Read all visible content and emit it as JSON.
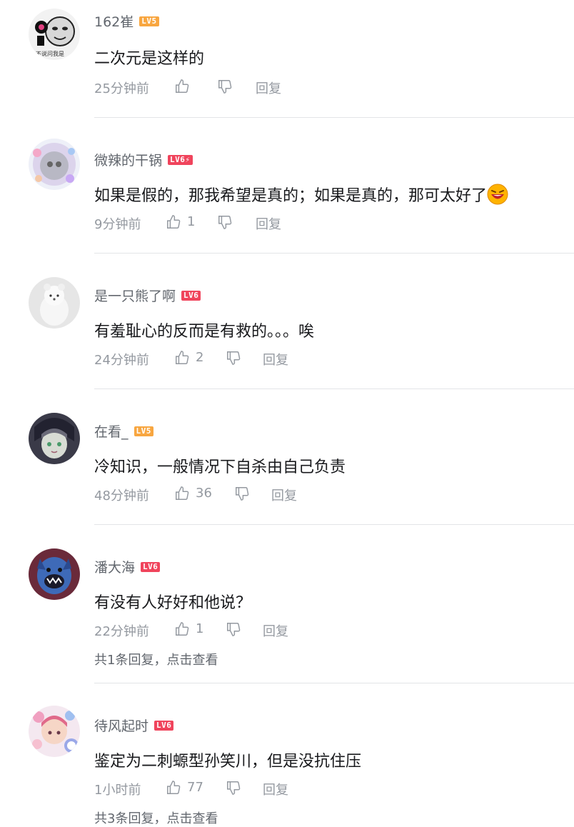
{
  "comments": [
    {
      "username": "162崔",
      "level": "LV5",
      "content": "二次元是这样的",
      "time": "25分钟前",
      "likes": "",
      "reply_label": "回复",
      "sub_replies": "",
      "avatar_caption": "不说问我是"
    },
    {
      "username": "微辣的干锅",
      "level": "LV6⚡",
      "content": "如果是假的，那我希望是真的；如果是真的，那可太好了",
      "time": "9分钟前",
      "likes": "1",
      "reply_label": "回复",
      "sub_replies": ""
    },
    {
      "username": "是一只熊了啊",
      "level": "LV6",
      "content": "有羞耻心的反而是有救的。。。唉",
      "time": "24分钟前",
      "likes": "2",
      "reply_label": "回复",
      "sub_replies": ""
    },
    {
      "username": "在看_",
      "level": "LV5",
      "content": "冷知识，一般情况下自杀由自己负责",
      "time": "48分钟前",
      "likes": "36",
      "reply_label": "回复",
      "sub_replies": ""
    },
    {
      "username": "潘大海",
      "level": "LV6",
      "content": "有没有人好好和他说？",
      "time": "22分钟前",
      "likes": "1",
      "reply_label": "回复",
      "sub_replies": "共1条回复，点击查看"
    },
    {
      "username": "待风起时",
      "level": "LV6",
      "content": "鉴定为二刺螈型孙笑川，但是没抗住压",
      "time": "1小时前",
      "likes": "77",
      "reply_label": "回复",
      "sub_replies": "共3条回复，点击查看"
    }
  ],
  "colors": {
    "username": "#61666d",
    "meta": "#9499a0",
    "lv5": "#f8a640",
    "lv6": "#f0445c",
    "divider": "#e3e5e7"
  }
}
